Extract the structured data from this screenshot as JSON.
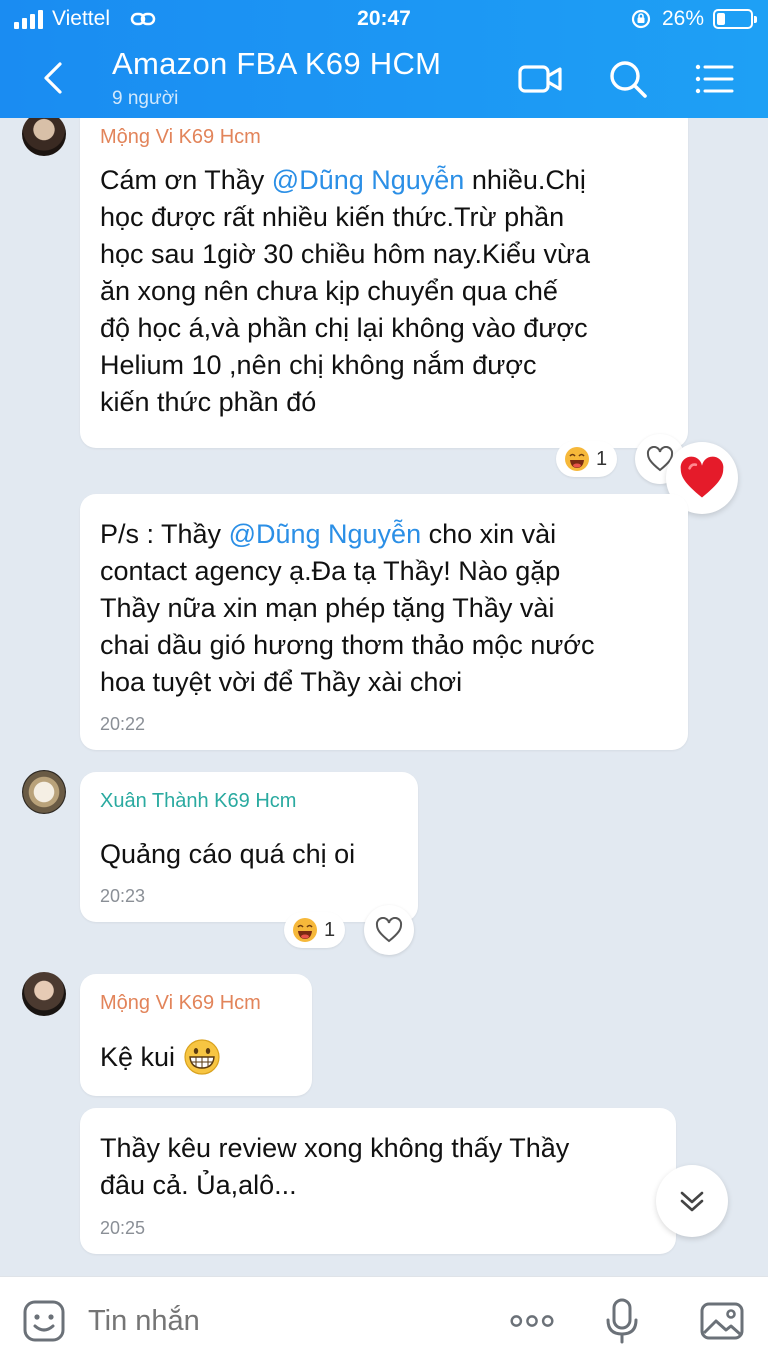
{
  "status_bar": {
    "carrier": "Viettel",
    "time": "20:47",
    "battery_percent": "26%",
    "battery_level": 0.26
  },
  "header": {
    "title": "Amazon FBA K69 HCM",
    "subtitle": "9 người",
    "icons": [
      "back-arrow-icon",
      "video-call-icon",
      "search-icon",
      "menu-icon"
    ]
  },
  "messages": [
    {
      "sender": "Mộng Vi K69 Hcm",
      "text_lines": [
        [
          "Cám ơn Thầy ",
          "@Dũng Nguyễn",
          " nhiều.Chị"
        ],
        [
          "học được rất nhiều kiến thức.Trừ phần"
        ],
        [
          "học sau 1giờ 30 chiều hôm nay.Kiểu vừa"
        ],
        [
          "ăn xong nên chưa kịp chuyển qua chế"
        ],
        [
          "độ học á,và phần chị lại không vào được"
        ],
        [
          "Helium 10 ,nên chị không nắm được"
        ],
        [
          "kiến thức phần đó"
        ]
      ],
      "reaction_count": "1"
    },
    {
      "text_lines": [
        [
          "P/s : Thầy ",
          "@Dũng Nguyễn",
          " cho xin vài"
        ],
        [
          "contact agency ạ.Đa tạ Thầy! Nào gặp"
        ],
        [
          "Thầy nữa xin mạn phép tặng Thầy vài"
        ],
        [
          "chai dầu gió hương thơm thảo mộc nước"
        ],
        [
          "hoa tuyệt vời để Thầy xài chơi"
        ]
      ],
      "time": "20:22"
    },
    {
      "sender": "Xuân Thành K69 Hcm",
      "text": "Quảng cáo quá chị oi",
      "time": "20:23",
      "reaction_count": "1"
    },
    {
      "sender": "Mộng Vi K69 Hcm",
      "text": "Kệ kui"
    },
    {
      "text_lines": [
        [
          "Thầy kêu review xong không thấy Thầy"
        ],
        [
          "đâu cả. Ủa,alô..."
        ]
      ],
      "time": "20:25"
    }
  ],
  "input": {
    "placeholder": "Tin nhắn"
  },
  "colors": {
    "header_blue": "#1a8cf2",
    "mention_blue": "#2b8fe6",
    "sender_orange": "#e2845a",
    "sender_teal": "#2aaaa0",
    "chat_background": "#e2e9f1"
  }
}
